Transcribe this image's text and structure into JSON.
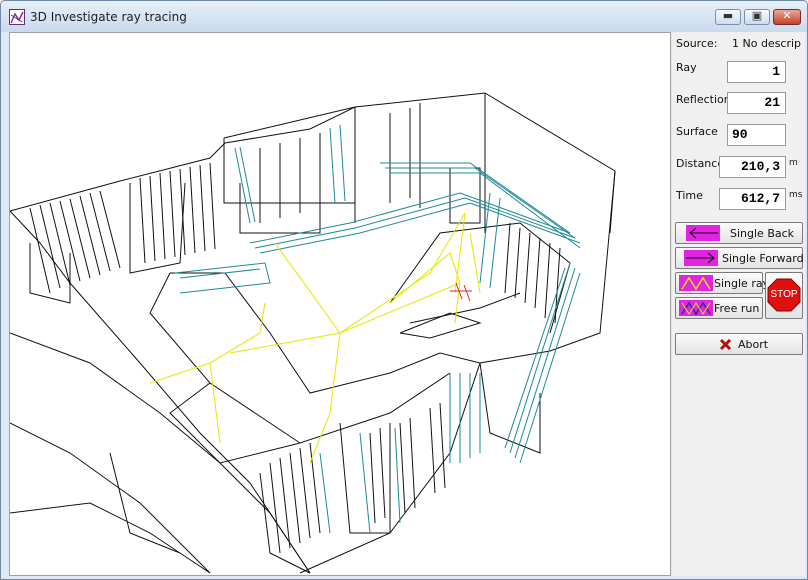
{
  "window": {
    "title": "3D Investigate ray tracing"
  },
  "colors": {
    "viewport_bg": "#ffffff",
    "geometry": "#111111",
    "surfaces": "#1f8a96",
    "rays": "#e6e600",
    "source": "#e02020"
  },
  "icons": [
    "app-icon",
    "minimize-icon",
    "maximize-icon",
    "close-icon",
    "arrow-left-icon",
    "arrow-right-icon",
    "single-ray-icon",
    "free-run-icon",
    "stop-sign-icon",
    "abort-x-icon"
  ],
  "panel": {
    "source_label": "Source:",
    "source_value": "1 No descrip",
    "ray_label": "Ray",
    "ray_value": "1",
    "reflection_label": "Reflection",
    "reflection_value": "21",
    "surface_label": "Surface",
    "surface_value": "90",
    "distance_label": "Distance",
    "distance_value": "210,3",
    "distance_unit": "m",
    "time_label": "Time",
    "time_value": "612,7",
    "time_unit": "ms"
  },
  "buttons": {
    "single_back": "Single Back",
    "single_forward": "Single Forward",
    "single_ray": "Single ray",
    "free_run": "Free run",
    "stop": "STOP",
    "abort": "Abort"
  }
}
